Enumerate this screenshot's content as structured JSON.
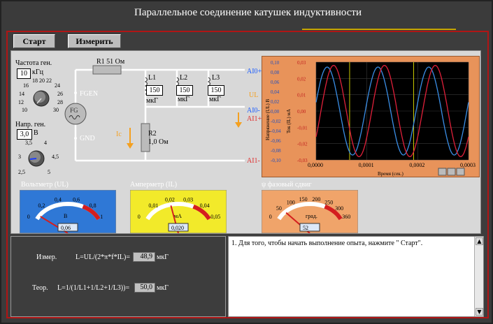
{
  "window": {
    "title": "Параллельное соединение катушек индуктивности"
  },
  "toolbar": {
    "start_label": "Старт",
    "measure_label": "Измерить"
  },
  "generator": {
    "freq_label": "Частота ген.",
    "freq_value": "10",
    "freq_unit": "кГц",
    "freq_scale": [
      "18",
      "20",
      "22",
      "16",
      "24",
      "14",
      "26",
      "12",
      "28",
      "10",
      "30"
    ],
    "volt_label": "Напр. ген.",
    "volt_value": "3,0",
    "volt_unit": "В",
    "volt_scale": [
      "3,5",
      "4",
      "3",
      "4,5",
      "2,5",
      "5"
    ],
    "fgen_label": "FGEN",
    "gnd_label": "GND",
    "fg_label": "FG"
  },
  "circuit": {
    "r1_label": "R1 51 Ом",
    "l1_label": "L1",
    "l1_value": "150",
    "l1_unit": "мкГ",
    "l2_label": "L2",
    "l2_value": "150",
    "l2_unit": "мкГ",
    "l3_label": "L3",
    "l3_value": "150",
    "l3_unit": "мкГ",
    "r2_label": "R2",
    "r2_value": "1,0 Ом",
    "ic_label": "Ic",
    "ul_label": "UL",
    "ai0p": "AI0+",
    "ai0m": "AI0-",
    "ai1p": "AI1+",
    "ai1m": "AI1-"
  },
  "chart_data": {
    "type": "line",
    "ylabel_left": "Напряжение (UL) В",
    "ylabel_right": "Ток (IL) мА",
    "xlabel": "Время (сек.)",
    "x_ticks": [
      "0,0000",
      "0,0001",
      "0,0002",
      "0,0003"
    ],
    "y_left_ticks": [
      "0,10",
      "0,08",
      "0,06",
      "0,04",
      "0,02",
      "0,00",
      "-0,02",
      "-0,04",
      "-0,06",
      "-0,08",
      "-0,10"
    ],
    "y_right_ticks": [
      "0,03",
      "0,02",
      "0,01",
      "0,00",
      "-0,01",
      "-0,02",
      "-0,03"
    ],
    "xlim": [
      0,
      0.0003
    ],
    "ylim_left": [
      -0.1,
      0.1
    ],
    "ylim_right": [
      -0.03,
      0.03
    ],
    "series": [
      {
        "color": "#3a8ee6",
        "amplitude": 0.09,
        "axis": "left"
      },
      {
        "color": "#e0203a",
        "amplitude": 0.028,
        "axis": "right"
      }
    ],
    "frequency_hz": 10000
  },
  "meters": {
    "voltmeter": {
      "label": "Вольтметр (UL)",
      "unit": "В",
      "scale": [
        "0",
        "0,2",
        "0,4",
        "0,6",
        "0,8",
        "1"
      ],
      "value": "0,06"
    },
    "ammeter": {
      "label": "Амперметр (IL)",
      "unit": "мА",
      "scale": [
        "0",
        "0,01",
        "0,02",
        "0,03",
        "0,04",
        "0,05"
      ],
      "value": "0,020"
    },
    "phase": {
      "label": "ψ фазовый сдвиг",
      "unit": "град.",
      "scale": [
        "0",
        "50",
        "100",
        "150",
        "200",
        "250",
        "300",
        "360"
      ],
      "value": "52"
    }
  },
  "results": {
    "meas_label": "Измер.",
    "meas_formula": "L=UL/(2*π*f*IL)=",
    "meas_value": "48,9",
    "meas_unit": "мкГ",
    "theor_label": "Теор.",
    "theor_formula": "L=1/(1/L1+1/L2+1/L3))=",
    "theor_value": "50,0",
    "theor_unit": "мкГ"
  },
  "message": {
    "text": "1. Для того, чтобы начать выполнение опыта, нажмите \" Старт\"."
  },
  "colors": {
    "voltmeter_bg": "#2f78d6",
    "ammeter_bg": "#f2ea2a",
    "phase_bg": "#f0a46a",
    "chart_bg": "#e8935a",
    "frame": "#b01515"
  }
}
